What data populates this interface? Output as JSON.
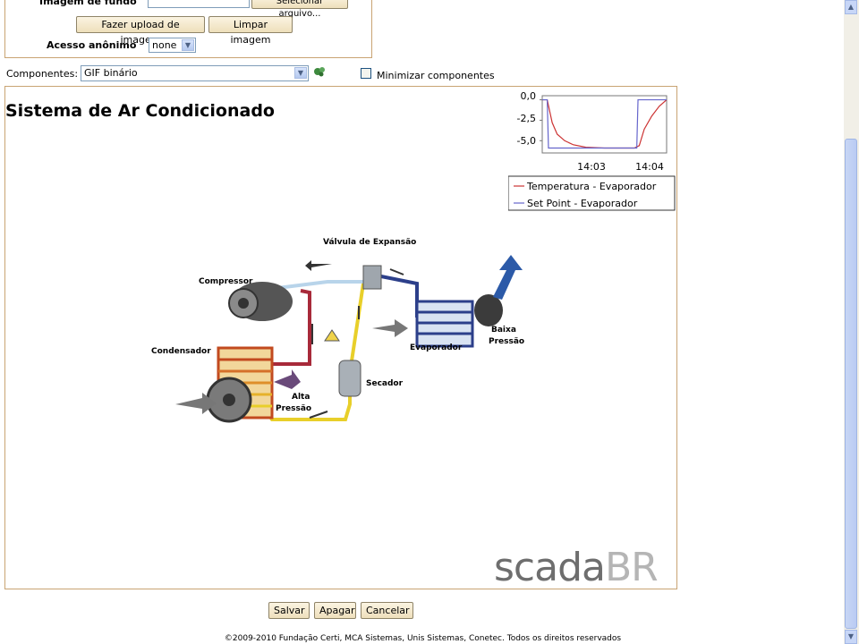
{
  "form": {
    "background_image_label": "Imagem de fundo",
    "select_file_button": "Selecionar arquivo...",
    "upload_button": "Fazer upload de imagem",
    "clear_button": "Limpar imagem",
    "anonymous_access_label": "Acesso anônimo",
    "anonymous_access_value": "none"
  },
  "components": {
    "label": "Componentes:",
    "selected": "GIF binário",
    "minimize_label": "Minimizar componentes",
    "minimize_checked": false
  },
  "canvas": {
    "title": "Sistema de Ar Condicionado",
    "logo_left": "scada",
    "logo_right": "BR"
  },
  "diagram_labels": {
    "expansion_valve": "Válvula de Expansão",
    "compressor": "Compressor",
    "condenser": "Condensador",
    "high_pressure_1": "Alta",
    "high_pressure_2": "Pressão",
    "dryer": "Secador",
    "evaporator": "Evaporador",
    "low_pressure_1": "Baixa",
    "low_pressure_2": "Pressão"
  },
  "chart_data": {
    "type": "line",
    "ytick_labels": [
      "0,0",
      "-2,5",
      "-5,0"
    ],
    "xtick_labels": [
      "14:03",
      "14:04"
    ],
    "ylim": [
      -6.5,
      0.5
    ],
    "series": [
      {
        "name": "Temperatura - Evaporador",
        "color": "#cc3333",
        "x": [
          0,
          0.04,
          0.08,
          0.12,
          0.18,
          0.25,
          0.35,
          0.5,
          0.65,
          0.74,
          0.78,
          0.82,
          0.88,
          0.94,
          1.0
        ],
        "y": [
          0,
          0,
          -2.8,
          -4.2,
          -5.0,
          -5.5,
          -5.8,
          -5.9,
          -5.9,
          -5.9,
          -5.6,
          -3.6,
          -2.0,
          -0.8,
          0
        ]
      },
      {
        "name": "Set Point - Evaporador",
        "color": "#6666cc",
        "x": [
          0,
          0.04,
          0.05,
          0.76,
          0.77,
          1.0
        ],
        "y": [
          0,
          0,
          -5.9,
          -5.9,
          0,
          0
        ]
      }
    ],
    "legend_position": "bottom"
  },
  "footer": {
    "save": "Salvar",
    "delete": "Apagar",
    "cancel": "Cancelar",
    "copyright": "©2009-2010 Fundação Certi, MCA Sistemas, Unis Sistemas, Conetec. Todos os direitos reservados"
  },
  "colors": {
    "form_border": "#c9a473",
    "button_fill": "#f4ead0",
    "hot_pipe": "#a82a3a",
    "cold_pipe": "#2c3f8a",
    "liquid_pipe": "#e8cf2a"
  }
}
